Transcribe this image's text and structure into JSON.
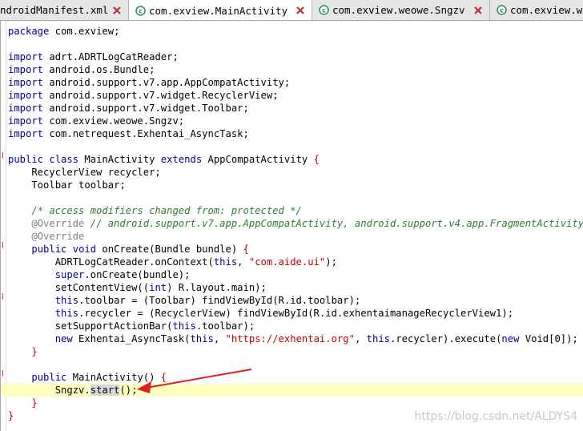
{
  "tabs": [
    {
      "label": "ndroidManifest.xml",
      "active": false
    },
    {
      "label": "com.exview.MainActivity",
      "active": true
    },
    {
      "label": "com.exview.weowe.Sngzv",
      "active": false
    },
    {
      "label": "com.exview.wi",
      "active": false
    }
  ],
  "code": {
    "l1_a": "package",
    "l1_b": " com.exview;",
    "imports": [
      " adrt.ADRTLogCatReader;",
      " android.os.Bundle;",
      " android.support.v7.app.AppCompatActivity;",
      " android.support.v7.widget.RecyclerView;",
      " android.support.v7.widget.Toolbar;",
      " com.exview.weowe.Sngzv;",
      " com.netrequest.Exhentai_AsyncTask;"
    ],
    "import_kw": "import",
    "class_public": "public",
    "class_kw": "class",
    "class_name": " MainActivity ",
    "extends_kw": "extends",
    "class_parent": " AppCompatActivity ",
    "open_brace": "{",
    "close_brace": "}",
    "field1": "    RecyclerView recycler;",
    "field2": "    Toolbar toolbar;",
    "comment1": "    /* access modifiers changed from: protected */",
    "override": "@Override",
    "override_comment": " // android.support.v7.app.AppCompatActivity, android.support.v4.app.FragmentActivity",
    "void_kw": "void",
    "oncreate_sig": " onCreate(Bundle bundle) ",
    "s1_a": "        ADRTLogCatReader.onContext(",
    "this_kw": "this",
    "s1_b": ", ",
    "s1_str": "\"com.aide.ui\"",
    "s1_c": ");",
    "super_kw": "super",
    "s2_b": ".onCreate(bundle);",
    "s3_a": "        setContentView((",
    "int_kw": "int",
    "s3_b": ") R.layout.main);",
    "s4_b": ".toolbar = (Toolbar) findViewById(R.id.toolbar);",
    "s5_b": ".recycler = (RecyclerView) findViewById(R.id.exhentaimanageRecyclerView1);",
    "s6_a": "        setSupportActionBar(",
    "s6_b": ".toolbar);",
    "new_kw": "new",
    "s7_a": " Exhentai_AsyncTask(",
    "s7_b": ", ",
    "s7_str": "\"https://exhentai.org\"",
    "s7_c": ", ",
    "s7_d": ".recycler).execute(",
    "s7_e": " Void[0]);",
    "ctor_sig": " MainActivity() ",
    "sngzv_a": "        Sngzv.",
    "sngzv_sel": "start",
    "sngzv_b": "();"
  },
  "watermark": "https://blog.csdn.net/ALDYS4",
  "colors": {
    "keyword": "#00008b",
    "string": "#c00000",
    "comment": "#2e7d32",
    "arrow": "#e02020",
    "current_line": "#ffffc0"
  }
}
